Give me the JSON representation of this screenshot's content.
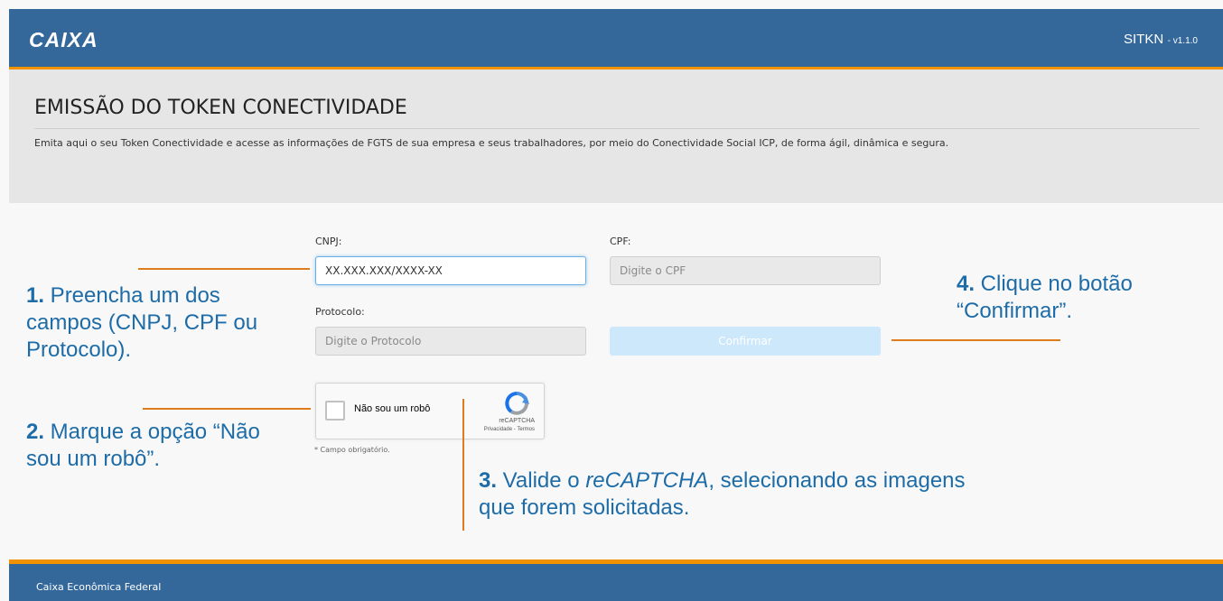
{
  "header": {
    "logo": "CAIXA",
    "system_name": "SITKN",
    "version": "- v1.1.0"
  },
  "page": {
    "title": "EMISSÃO DO TOKEN CONECTIVIDADE",
    "description": "Emita aqui o seu Token Conectividade e acesse as informações de FGTS de sua empresa e seus trabalhadores, por meio do Conectividade Social ICP, de forma ágil, dinâmica e segura."
  },
  "form": {
    "cnpj": {
      "label": "CNPJ:",
      "placeholder": "XX.XXX.XXX/XXXX-XX"
    },
    "cpf": {
      "label": "CPF:",
      "placeholder": "Digite o CPF"
    },
    "protocolo": {
      "label": "Protocolo:",
      "placeholder": "Digite o Protocolo"
    },
    "confirm_label": "Confirmar",
    "recaptcha": {
      "label": "Não sou um robô",
      "brand": "reCAPTCHA",
      "links": "Privacidade - Termos"
    },
    "required_note": "* Campo obrigatório."
  },
  "annotations": {
    "step1": {
      "num": "1.",
      "text": " Preencha um dos campos (CNPJ, CPF ou Protocolo)."
    },
    "step2": {
      "num": "2.",
      "text": " Marque a opção “Não sou um robô”."
    },
    "step3": {
      "num": "3.",
      "text_a": " Valide o ",
      "text_em": "reCAPTCHA",
      "text_b": ", selecionando as imagens que forem solicitadas."
    },
    "step4": {
      "num": "4.",
      "text": " Clique no botão “Confirmar”."
    }
  },
  "footer": {
    "text": "Caixa Econômica Federal"
  },
  "colors": {
    "primary": "#34689a",
    "accent": "#f39200",
    "annotation": "#1d6ca7",
    "annotation_line": "#e07b1c"
  }
}
